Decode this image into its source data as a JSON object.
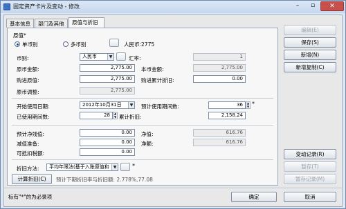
{
  "window": {
    "title": "固定资产卡片及变动 - 修改",
    "min_glyph": "–",
    "max_glyph": "▫",
    "close_glyph": "✕"
  },
  "tabs": [
    {
      "label": "基本信息"
    },
    {
      "label": "部门及其他"
    },
    {
      "label": "原值与折旧"
    }
  ],
  "form": {
    "original_value_label": "原值*",
    "currency_mode": {
      "single": "单币别",
      "multi": "多币别",
      "selected": "single"
    },
    "rmb_info": "人民币:2775",
    "currency_label": "币别:",
    "currency_value": "人民币",
    "exchange_rate_label": "汇率:",
    "exchange_rate_value": "1",
    "orig_currency_amount_label": "原币金额:",
    "orig_currency_amount_value": "2,775.00",
    "local_amount_label": "本币金额:",
    "local_amount_value": "2,775.00",
    "purchase_value_label": "购进原值:",
    "purchase_value_value": "2,775.00",
    "purchase_accum_depr_label": "购进累计折旧:",
    "purchase_accum_depr_value": "0.00",
    "orig_adjustment_label": "原币调整:",
    "orig_adjustment_value": "2,775.00",
    "start_date_label": "开始使用日期:",
    "start_date_value": "2012年10月31日",
    "expected_periods_label": "预计使用期间数:",
    "expected_periods_value": "36",
    "used_periods_label": "已使用期间数:",
    "used_periods_value": "28",
    "accum_depr_label": "累计折旧:",
    "accum_depr_value": "2,158.24",
    "est_net_residual_label": "预计净残值:",
    "est_net_residual_value": "0.00",
    "net_value_label": "净值:",
    "net_value_value": "616.76",
    "impairment_label": "减值准备:",
    "impairment_value": "0.00",
    "net_amount_label": "净额:",
    "net_amount_value": "616.76",
    "deductible_tax_label": "可抵扣税额:",
    "deductible_tax_value": "0.00",
    "depr_method_label": "折旧方法:",
    "depr_method_value": "平均年限法(基于入账原值和",
    "calc_button": "计算折旧(C)",
    "next_period_info": "预计下期折旧率与折旧额:  2.778%,77.08",
    "required_star": "*"
  },
  "side_buttons": {
    "edit": "编辑(E)",
    "save": "保存(S)",
    "new": "新增(N)",
    "copy_new": "新增复制(C)",
    "change_record": "变动记录(R)",
    "pause": "暂存(T)",
    "pause_record": "暂存记录(M)"
  },
  "footer": {
    "note": "标有\"*\"的为必录项",
    "ok": "确定",
    "cancel": "取消"
  }
}
